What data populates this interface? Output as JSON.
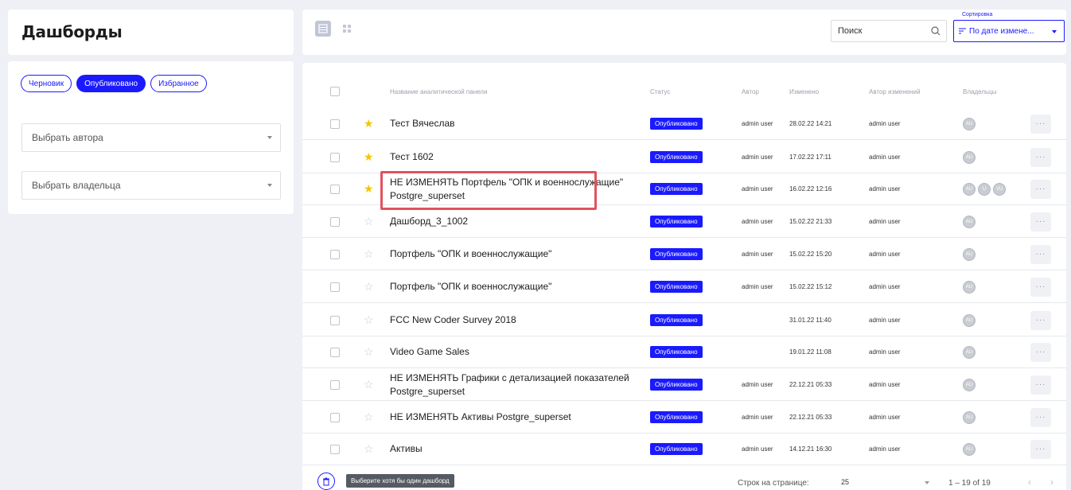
{
  "header": {
    "title": "Дашборды"
  },
  "filters": {
    "chips": [
      "Черновик",
      "Опубликовано",
      "Избранное"
    ],
    "active_chip": "Опубликовано",
    "author_select": "Выбрать автора",
    "owner_select": "Выбрать владельца"
  },
  "toolbar": {
    "search_placeholder": "Поиск",
    "sort_label": "Сортировка",
    "sort_value": "По дате измене..."
  },
  "table": {
    "columns": {
      "name": "Название аналитической панели",
      "status": "Статус",
      "author": "Автор",
      "modified": "Изменено",
      "modified_by": "Автор изменений",
      "owners": "Владельцы"
    },
    "rows": [
      {
        "name": "Тест Вячеслав",
        "status": "Опубликовано",
        "author": "admin user",
        "modified": "28.02.22 14:21",
        "modified_by": "admin user",
        "owners": [
          "AU"
        ],
        "favorite": true
      },
      {
        "name": "Тест 1602",
        "status": "Опубликовано",
        "author": "admin user",
        "modified": "17.02.22 17:11",
        "modified_by": "admin user",
        "owners": [
          "AU"
        ],
        "favorite": true
      },
      {
        "name": "НЕ ИЗМЕНЯТЬ Портфель \"ОПК и военнослужащие\" Postgre_superset",
        "status": "Опубликовано",
        "author": "admin user",
        "modified": "16.02.22 12:16",
        "modified_by": "admin user",
        "owners": [
          "AU",
          "U",
          "VU"
        ],
        "favorite": true
      },
      {
        "name": "Дашборд_3_1002",
        "status": "Опубликовано",
        "author": "admin user",
        "modified": "15.02.22 21:33",
        "modified_by": "admin user",
        "owners": [
          "AU"
        ],
        "favorite": false
      },
      {
        "name": "Портфель \"ОПК и военнослужащие\"",
        "status": "Опубликовано",
        "author": "admin user",
        "modified": "15.02.22 15:20",
        "modified_by": "admin user",
        "owners": [
          "AU"
        ],
        "favorite": false
      },
      {
        "name": "Портфель \"ОПК и военнослужащие\"",
        "status": "Опубликовано",
        "author": "admin user",
        "modified": "15.02.22 15:12",
        "modified_by": "admin user",
        "owners": [
          "AU"
        ],
        "favorite": false
      },
      {
        "name": "FCC New Coder Survey 2018",
        "status": "Опубликовано",
        "author": "",
        "modified": "31.01.22 11:40",
        "modified_by": "admin user",
        "owners": [
          "AU"
        ],
        "favorite": false
      },
      {
        "name": "Video Game Sales",
        "status": "Опубликовано",
        "author": "",
        "modified": "19.01.22 11:08",
        "modified_by": "admin user",
        "owners": [
          "AU"
        ],
        "favorite": false
      },
      {
        "name": "НЕ ИЗМЕНЯТЬ Графики с детализацией показателей Postgre_superset",
        "status": "Опубликовано",
        "author": "admin user",
        "modified": "22.12.21 05:33",
        "modified_by": "admin user",
        "owners": [
          "AU"
        ],
        "favorite": false
      },
      {
        "name": "НЕ ИЗМЕНЯТЬ Активы Postgre_superset",
        "status": "Опубликовано",
        "author": "admin user",
        "modified": "22.12.21 05:33",
        "modified_by": "admin user",
        "owners": [
          "AU"
        ],
        "favorite": false
      },
      {
        "name": "Активы",
        "status": "Опубликовано",
        "author": "admin user",
        "modified": "14.12.21 16:30",
        "modified_by": "admin user",
        "owners": [
          "AU"
        ],
        "favorite": false
      }
    ]
  },
  "footer": {
    "tooltip": "Выберите хотя бы один дашборд",
    "rows_per_page_label": "Строк на странице:",
    "rows_per_page": "25",
    "pagination": "1 – 19 of 19"
  },
  "colors": {
    "accent": "#1a1aff",
    "highlight": "#e0525e",
    "star": "#f5c400"
  }
}
